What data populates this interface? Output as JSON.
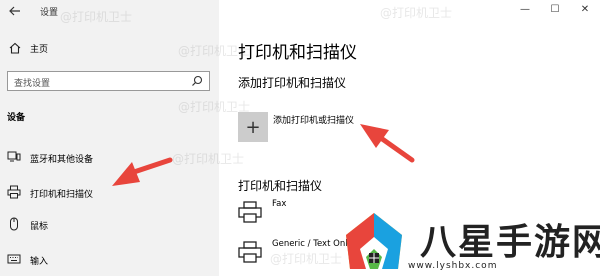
{
  "window": {
    "title": "设置",
    "controls": {
      "minimize": "—",
      "maximize": "☐",
      "close": "✕"
    }
  },
  "sidebar": {
    "home_label": "主页",
    "search_placeholder": "查找设置",
    "section_label": "设备",
    "items": [
      {
        "label": "蓝牙和其他设备",
        "icon": "bluetooth-devices-icon"
      },
      {
        "label": "打印机和扫描仪",
        "icon": "printer-icon"
      },
      {
        "label": "鼠标",
        "icon": "mouse-icon"
      },
      {
        "label": "输入",
        "icon": "keyboard-icon"
      }
    ]
  },
  "main": {
    "title": "打印机和扫描仪",
    "add_section_heading": "添加打印机和扫描仪",
    "add_button_label": "添加打印机或扫描仪",
    "list_heading": "打印机和扫描仪",
    "devices": [
      {
        "name": "Fax",
        "icon": "printer-icon"
      },
      {
        "name": "Generic / Text Only",
        "icon": "printer-icon"
      }
    ]
  },
  "watermark": {
    "text": "@打印机卫士"
  },
  "logo": {
    "name": "八星手游网",
    "url": "www.lyshbx.com"
  },
  "colors": {
    "sidebar_bg": "#f2f2f2",
    "add_button_bg": "#cccccc",
    "arrow": "#e8453c"
  }
}
